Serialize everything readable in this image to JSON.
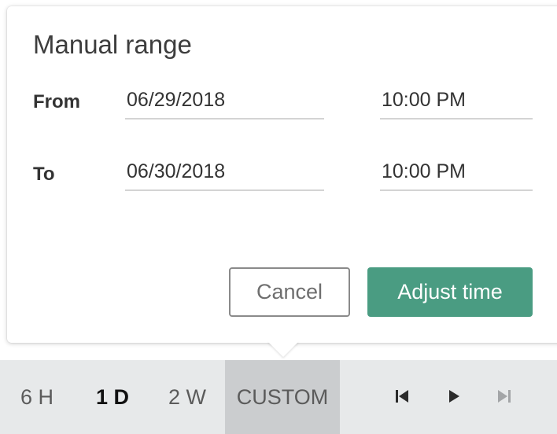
{
  "popup": {
    "title": "Manual range",
    "from": {
      "label": "From",
      "date": "06/29/2018",
      "time": "10:00 PM"
    },
    "to": {
      "label": "To",
      "date": "06/30/2018",
      "time": "10:00 PM"
    },
    "cancel_label": "Cancel",
    "adjust_label": "Adjust time",
    "accent_color": "#4a9c82"
  },
  "toolbar": {
    "ranges": [
      {
        "label": "6 H",
        "selected": false
      },
      {
        "label": "1 D",
        "selected": true
      },
      {
        "label": "2 W",
        "selected": false
      },
      {
        "label": "CUSTOM",
        "active": true
      }
    ],
    "controls": [
      {
        "icon": "skip-to-start-icon",
        "enabled": true
      },
      {
        "icon": "play-icon",
        "enabled": true
      },
      {
        "icon": "skip-to-end-icon",
        "enabled": false
      }
    ]
  }
}
